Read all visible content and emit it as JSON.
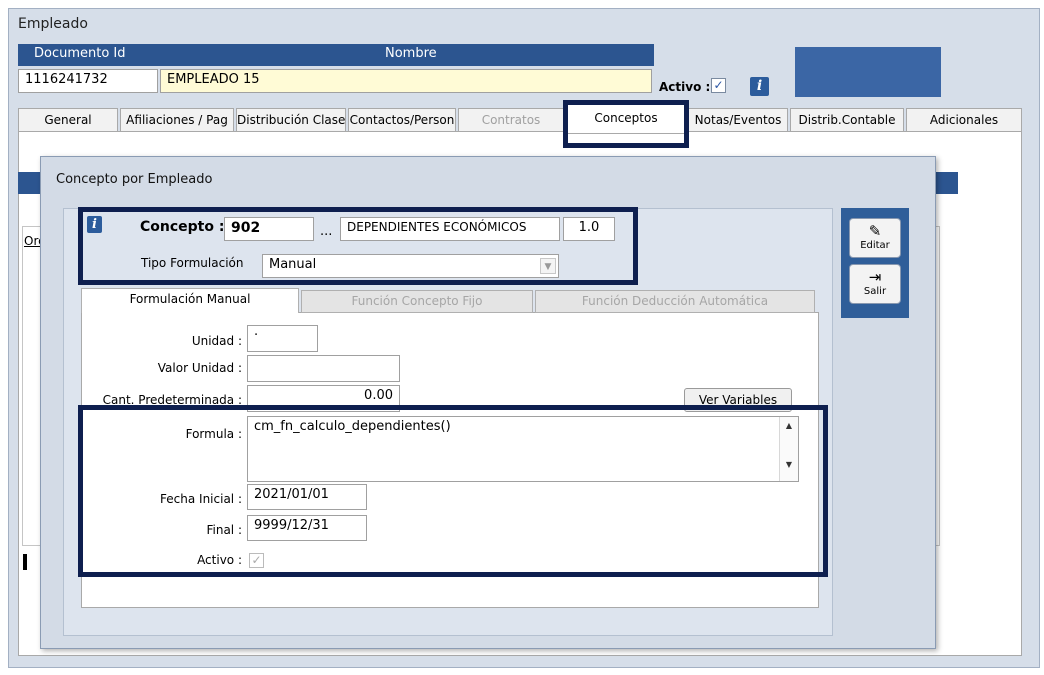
{
  "window": {
    "title": "Empleado"
  },
  "header": {
    "doc_label": "Documento Id",
    "name_label": "Nombre",
    "doc_value": "1116241732",
    "name_value": "EMPLEADO 15",
    "activo_label": "Activo :",
    "activo_checked": "✓",
    "info_icon": "i"
  },
  "tabs": [
    {
      "label": "General"
    },
    {
      "label": "Afiliaciones / Pag"
    },
    {
      "label": "Distribución Clase"
    },
    {
      "label": "Contactos/Person"
    },
    {
      "label": "Contratos"
    },
    {
      "label": "Conceptos"
    },
    {
      "label": "Notas/Eventos"
    },
    {
      "label": "Distrib.Contable"
    },
    {
      "label": "Adicionales"
    }
  ],
  "background_grid": {
    "column_label": "Orc"
  },
  "dialog": {
    "title": "Concepto por Empleado",
    "info_icon": "i",
    "concepto_label": "Concepto :",
    "concepto_code": "902",
    "ellipsis": "...",
    "concepto_desc": "DEPENDIENTES ECONÓMICOS",
    "concepto_version": "1.0",
    "tipo_label": "Tipo Formulación",
    "tipo_value": "Manual",
    "subtabs": [
      {
        "label": "Formulación Manual"
      },
      {
        "label": "Función Concepto Fijo"
      },
      {
        "label": "Función Deducción Automática"
      }
    ],
    "form": {
      "unidad_label": "Unidad :",
      "unidad_value": "·",
      "valor_label": "Valor Unidad :",
      "valor_value": "",
      "cant_label": "Cant. Predeterminada :",
      "cant_value": "0.00",
      "ver_variables": "Ver Variables",
      "formula_label": "Formula :",
      "formula_value": "cm_fn_calculo_dependientes()",
      "fecha_inicial_label": "Fecha Inicial :",
      "fecha_inicial_value": "2021/01/01",
      "final_label": "Final :",
      "final_value": "9999/12/31",
      "activo_label": "Activo :",
      "activo_checked": "✓"
    },
    "toolbar": {
      "editar_label": "Editar",
      "salir_label": "Salir"
    }
  },
  "icons": {
    "info": "info-icon",
    "edit": "edit-icon",
    "exit": "exit-icon"
  },
  "colors": {
    "header_blue": "#2c5590",
    "highlight": "#0e1f4f",
    "name_bg": "#fffbd6"
  }
}
